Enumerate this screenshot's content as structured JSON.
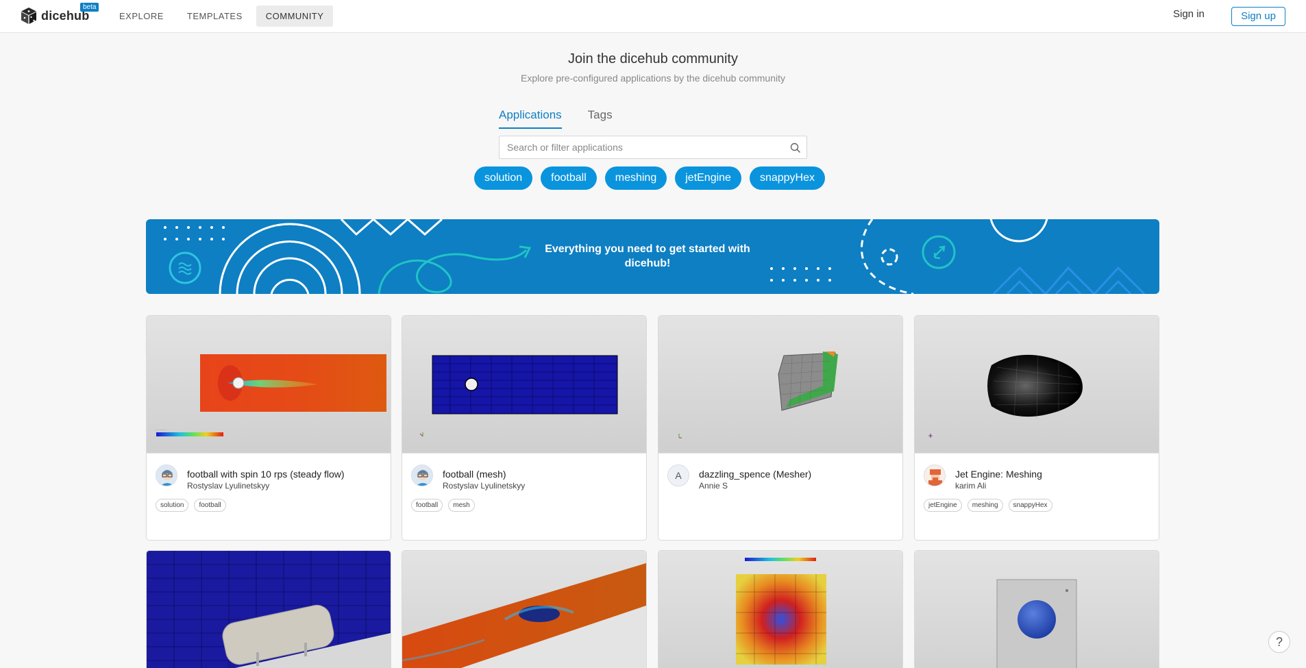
{
  "header": {
    "logo_text": "dicehub",
    "beta_badge": "beta",
    "nav": [
      "EXPLORE",
      "TEMPLATES",
      "COMMUNITY"
    ],
    "active_nav": "COMMUNITY",
    "signin_label": "Sign in",
    "signup_label": "Sign up"
  },
  "hero": {
    "title": "Join the dicehub community",
    "subtitle": "Explore pre-configured applications by the dicehub community"
  },
  "tabs": [
    "Applications",
    "Tags"
  ],
  "active_tab": "Applications",
  "search": {
    "placeholder": "Search or filter applications",
    "value": ""
  },
  "tag_filters": [
    "solution",
    "football",
    "meshing",
    "jetEngine",
    "snappyHex"
  ],
  "banner": {
    "text": "Everything you need to get started with dicehub!"
  },
  "cards": [
    {
      "title": "football with spin 10 rps (steady flow)",
      "author": "Rostyslav Lyulinetskyy",
      "tags": [
        "solution",
        "football"
      ],
      "avatar": ""
    },
    {
      "title": "football (mesh)",
      "author": "Rostyslav Lyulinetskyy",
      "tags": [
        "football",
        "mesh"
      ],
      "avatar": ""
    },
    {
      "title": "dazzling_spence (Mesher)",
      "author": "Annie S",
      "tags": [],
      "avatar": "A"
    },
    {
      "title": "Jet Engine: Meshing",
      "author": "karim Ali",
      "tags": [
        "jetEngine",
        "meshing",
        "snappyHex"
      ],
      "avatar": ""
    }
  ],
  "help_label": "?",
  "colors": {
    "accent": "#0e7fc3",
    "pill": "#0a94dd",
    "banner": "#0e7fc3"
  }
}
